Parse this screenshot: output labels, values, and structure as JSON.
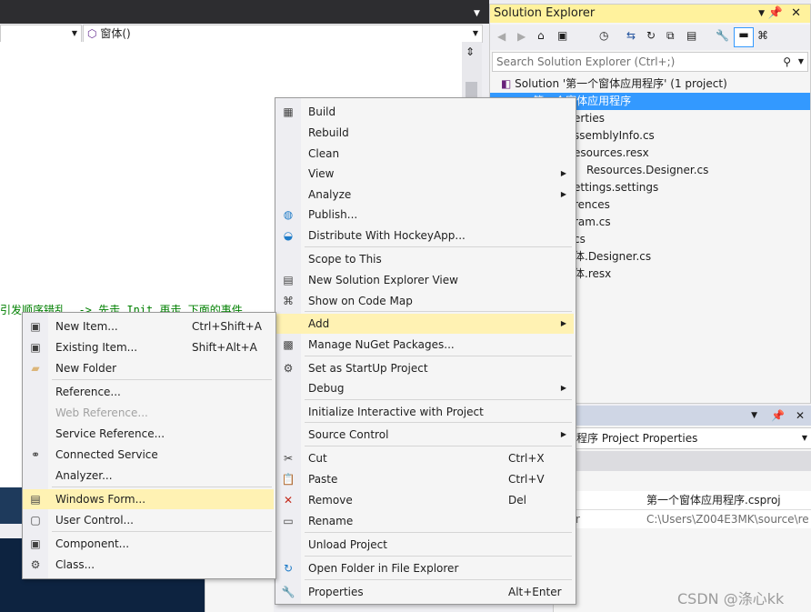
{
  "editor": {
    "member_combo": "窗体()",
    "comment_text": "引发顺序错乱. -> 先走 Init 再走 下面的事件"
  },
  "solution_explorer": {
    "title": "Solution Explorer",
    "search_placeholder": "Search Solution Explorer (Ctrl+;)",
    "items": [
      {
        "label": "Solution '第一个窗体应用程序' (1 project)"
      },
      {
        "label": "第一个窗体应用程序"
      },
      {
        "label": "erties"
      },
      {
        "label": "ssemblyInfo.cs"
      },
      {
        "label": "esources.resx"
      },
      {
        "label": "Resources.Designer.cs"
      },
      {
        "label": "ettings.settings"
      },
      {
        "label": "rences"
      },
      {
        "label": "ram.cs"
      },
      {
        "label": "cs"
      },
      {
        "label": "体.Designer.cs"
      },
      {
        "label": "体.resx"
      }
    ]
  },
  "properties": {
    "title_suffix": "程序  Project Properties",
    "row1": "第一个窗体应用程序.csproj",
    "row2_label": "r",
    "row2": "C:\\Users\\Z004E3MK\\source\\re"
  },
  "context_menu": {
    "items": [
      {
        "label": "Build",
        "icon": "build-icon"
      },
      {
        "label": "Rebuild",
        "icon": ""
      },
      {
        "label": "Clean",
        "icon": ""
      },
      {
        "label": "View",
        "icon": "",
        "arrow": "▶"
      },
      {
        "label": "Analyze",
        "icon": "",
        "arrow": "▶"
      },
      {
        "label": "Publish...",
        "icon": "globe-icon"
      },
      {
        "label": "Distribute With HockeyApp...",
        "icon": "hockeyapp-icon"
      },
      {
        "label": "Scope to This",
        "icon": ""
      },
      {
        "label": "New Solution Explorer View",
        "icon": "new-view-icon"
      },
      {
        "label": "Show on Code Map",
        "icon": "code-map-icon"
      },
      {
        "label": "Add",
        "icon": "",
        "arrow": "▶"
      },
      {
        "label": "Manage NuGet Packages...",
        "icon": "nuget-icon"
      },
      {
        "label": "Set as StartUp Project",
        "icon": "gear-icon"
      },
      {
        "label": "Debug",
        "icon": "",
        "arrow": "▶"
      },
      {
        "label": "Initialize Interactive with Project",
        "icon": ""
      },
      {
        "label": "Source Control",
        "icon": "",
        "arrow": "▶"
      },
      {
        "label": "Cut",
        "icon": "scissors-icon",
        "shortcut": "Ctrl+X"
      },
      {
        "label": "Paste",
        "icon": "paste-icon",
        "shortcut": "Ctrl+V"
      },
      {
        "label": "Remove",
        "icon": "remove-icon",
        "shortcut": "Del"
      },
      {
        "label": "Rename",
        "icon": "rename-icon"
      },
      {
        "label": "Unload Project",
        "icon": ""
      },
      {
        "label": "Open Folder in File Explorer",
        "icon": "refresh-folder-icon"
      },
      {
        "label": "Properties",
        "icon": "wrench-icon",
        "shortcut": "Alt+Enter"
      }
    ]
  },
  "add_submenu": {
    "items": [
      {
        "label": "New Item...",
        "shortcut": "Ctrl+Shift+A"
      },
      {
        "label": "Existing Item...",
        "shortcut": "Shift+Alt+A"
      },
      {
        "label": "New Folder"
      },
      {
        "label": "Reference..."
      },
      {
        "label": "Web Reference..."
      },
      {
        "label": "Service Reference..."
      },
      {
        "label": "Connected Service"
      },
      {
        "label": "Analyzer..."
      },
      {
        "label": "Windows Form..."
      },
      {
        "label": "User Control..."
      },
      {
        "label": "Component..."
      },
      {
        "label": "Class..."
      }
    ]
  },
  "watermark": "CSDN @涤心kk",
  "colors": {
    "highlight": "#fff2b3",
    "selection": "#3399ff",
    "comment": "#008000"
  }
}
